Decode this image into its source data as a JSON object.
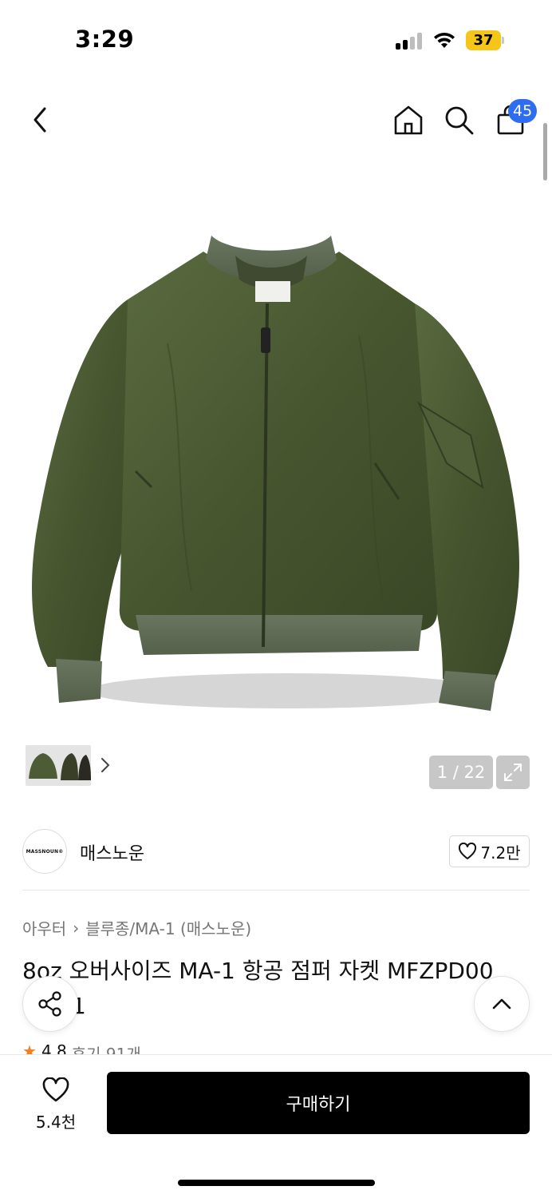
{
  "status_bar": {
    "time": "3:29",
    "battery": "37"
  },
  "nav": {
    "back_icon": "chevron-left-icon",
    "home_icon": "home-icon",
    "search_icon": "search-icon",
    "cart_icon": "shopping-bag-icon",
    "cart_badge": "45"
  },
  "gallery": {
    "counter": "1 / 22",
    "expand_icon": "expand-icon",
    "thumb_arrow_icon": "chevron-right-icon"
  },
  "brand": {
    "logo_text": "MASSNOUN®",
    "name": "매스노운",
    "likes": "7.2만"
  },
  "breadcrumb": {
    "category": "아우터",
    "separator": "›",
    "subcategory": "블루종/MA-1 (매스노운)"
  },
  "product": {
    "title": "8oz 오버사이즈 MA-1 항공 점퍼 자켓 MFZPD00",
    "title_cont": "1",
    "rating": "4.8",
    "reviews": "후기 91개"
  },
  "floating": {
    "share_icon": "share-icon",
    "top_icon": "chevron-up-icon"
  },
  "bottom": {
    "wish_count": "5.4천",
    "buy_label": "구매하기"
  },
  "colors": {
    "accent": "#2f6df0",
    "rating_star": "#f57e20",
    "buy_button": "#000000",
    "jacket": "#4a5a33"
  }
}
